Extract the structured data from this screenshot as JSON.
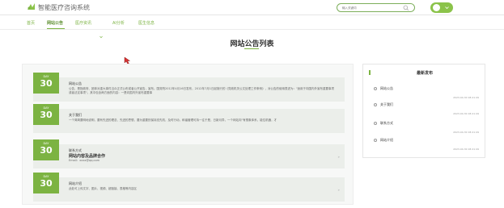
{
  "header": {
    "app_title": "智能医疗咨询系统",
    "search_placeholder": "输入关键词",
    "colors": {
      "brand_green": "#8bc34a",
      "nav_green": "#7cb342"
    }
  },
  "nav": {
    "items": [
      {
        "label": "首页",
        "active": false
      },
      {
        "label": "网站公告",
        "active": true
      },
      {
        "label": "医疗资讯",
        "active": false,
        "has_dropdown": true
      },
      {
        "label": "AI分析",
        "active": false
      },
      {
        "label": "医生信息",
        "active": false
      }
    ]
  },
  "page": {
    "title": "网站公告列表"
  },
  "notices": [
    {
      "day_label": "DAY",
      "day": "30",
      "title": "网站公告",
      "text": "公告，是指政府、团体对重大事件当众正式公布或者公开宣告，宣布。国务院2012年4月16日发布，2012年7月1日起施行的《党政机关公文处理工作条例》，对公告的使用表述为：\"适用于向国内外宣布重要事项或者法定事项\"。其中包含两方面的内容：一是向国内外宣布重要事"
    },
    {
      "day_label": "DAY",
      "day": "30",
      "title": "关于我们",
      "text": "一个简简要明地说明，要有先进的理念、先进的思想，要为重要的保持态先机，及时行动，和谐管理可持一往于是，日新月异，一个网站向\"有想象体系，能位机器，才"
    },
    {
      "day_label": "DAY",
      "day": "30",
      "title": "联系方式",
      "subtitle": "网站内容及品牌合作",
      "email": "Email：xxxx@qq.com"
    },
    {
      "day_label": "DAY",
      "day": "30",
      "title": "网站介绍",
      "text": "此处可上传文字、图片、视频、超链接、表格等内容区"
    }
  ],
  "sidebar": {
    "title": "最新发布",
    "items": [
      {
        "label": "网站公告",
        "date": "2023-04-30 18:21:49"
      },
      {
        "label": "关于我们",
        "date": "2023-04-30 18:21:49"
      },
      {
        "label": "联系方式",
        "date": "2023-04-30 18:21:49"
      },
      {
        "label": "网站介绍",
        "date": "2023-04-30 18:21:49"
      }
    ]
  }
}
